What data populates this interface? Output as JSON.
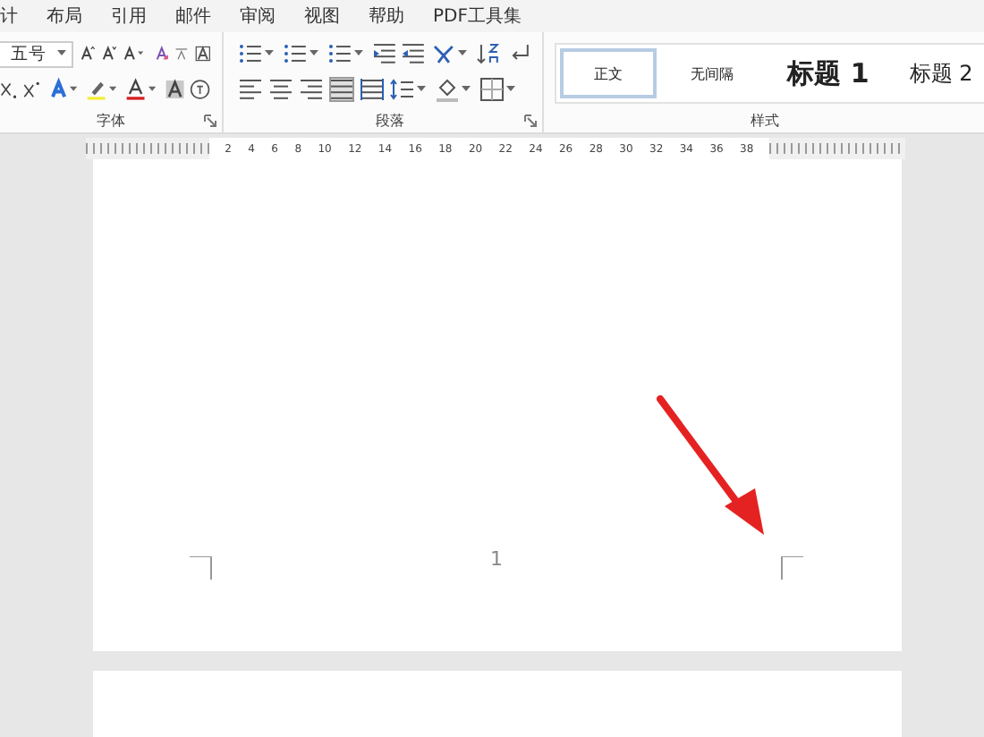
{
  "menu": [
    {
      "label": "计",
      "selected": false
    },
    {
      "label": "布局",
      "selected": false
    },
    {
      "label": "引用",
      "selected": false
    },
    {
      "label": "邮件",
      "selected": false
    },
    {
      "label": "审阅",
      "selected": false
    },
    {
      "label": "视图",
      "selected": false
    },
    {
      "label": "帮助",
      "selected": false
    },
    {
      "label": "PDF工具集",
      "selected": false
    }
  ],
  "font_group": {
    "font_size": "五号",
    "label": "字体"
  },
  "paragraph_group": {
    "label": "段落"
  },
  "styles_group": {
    "label": "样式",
    "styles": [
      {
        "label": "正文",
        "kind": "normal",
        "selected": true
      },
      {
        "label": "无间隔",
        "kind": "normal",
        "selected": false
      },
      {
        "label": "标题 1",
        "kind": "heading1",
        "selected": false
      },
      {
        "label": "标题 2",
        "kind": "heading2",
        "selected": false
      }
    ]
  },
  "ruler": {
    "numbers": [
      "2",
      "4",
      "6",
      "8",
      "10",
      "12",
      "14",
      "16",
      "18",
      "20",
      "22",
      "24",
      "26",
      "28",
      "30",
      "32",
      "34",
      "36",
      "38"
    ]
  },
  "page": {
    "page_number": "1"
  }
}
